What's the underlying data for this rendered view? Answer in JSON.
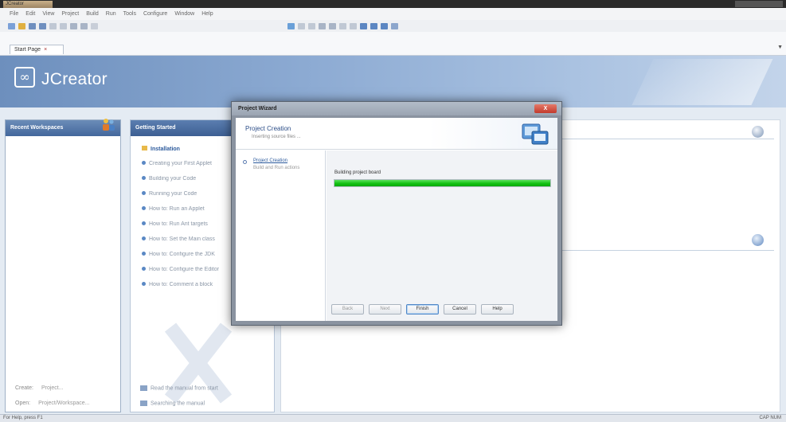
{
  "window": {
    "title": "JCreator"
  },
  "menu": [
    "File",
    "Edit",
    "View",
    "Project",
    "Build",
    "Run",
    "Tools",
    "Configure",
    "Window",
    "Help"
  ],
  "tabs": [
    {
      "label": "Start Page",
      "close": "×"
    }
  ],
  "banner": {
    "logo_text": "JCreator",
    "logo_mark": "JC"
  },
  "left_panel": {
    "title": "Recent Workspaces",
    "footer": [
      {
        "label": "Create:",
        "value": "Project..."
      },
      {
        "label": "Open:",
        "value": "Project/Workspace..."
      }
    ]
  },
  "mid_panel": {
    "title": "Getting Started",
    "items": [
      "Installation",
      "Creating your First Applet",
      "Building your Code",
      "Running your Code",
      "How to: Run an Applet",
      "How to: Run Ant targets",
      "How to: Set the Main class",
      "How to: Configure the JDK",
      "How to: Configure the Editor",
      "How to: Comment a block"
    ],
    "bottom": [
      "Read the manual from start",
      "Searching the manual"
    ]
  },
  "dialog": {
    "title": "Project Wizard",
    "close_label": "X",
    "header_title": "Project Creation",
    "header_subtitle": "Inserting source files ...",
    "step_title": "Project Creation",
    "step_subtitle": "Build and Run actions",
    "progress_label": "Building project board",
    "progress_value": 1.0,
    "buttons": {
      "back": "Back",
      "next": "Next",
      "finish": "Finish",
      "cancel": "Cancel",
      "help": "Help"
    }
  },
  "status": {
    "left": "For Help, press F1",
    "right": "CAP  NUM"
  },
  "colors": {
    "accent": "#43679c",
    "progress": "#13c213"
  }
}
